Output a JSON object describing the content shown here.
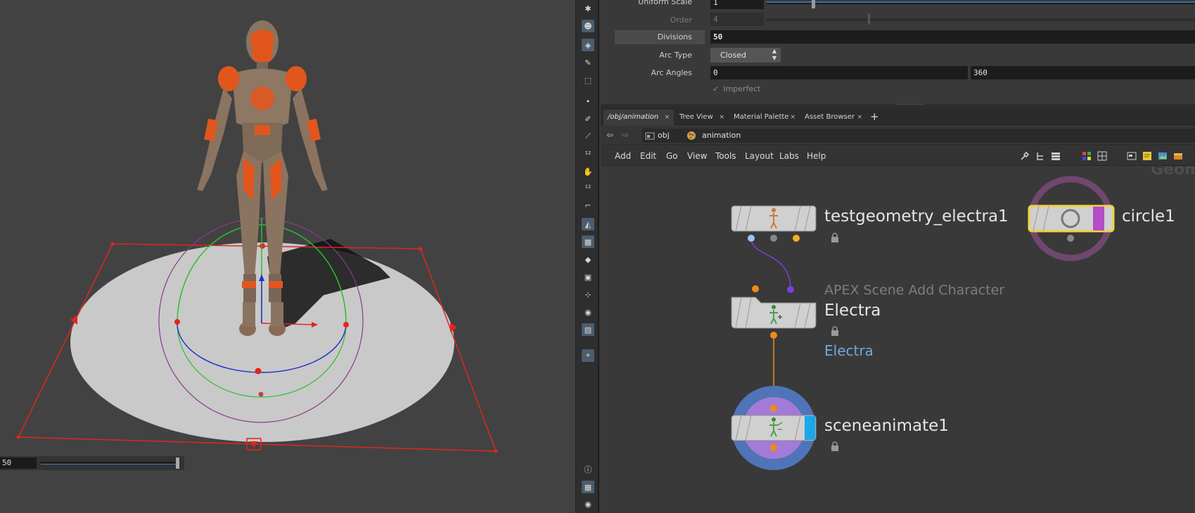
{
  "viewport": {
    "scale_value": "50"
  },
  "params": {
    "uniform_scale": {
      "label": "Uniform Scale",
      "value": "1"
    },
    "order": {
      "label": "Order",
      "value": "4"
    },
    "divisions": {
      "label": "Divisions",
      "value": "50"
    },
    "arc_type": {
      "label": "Arc Type",
      "value": "Closed"
    },
    "arc_angles": {
      "label": "Arc Angles",
      "value_start": "0",
      "value_end": "360"
    },
    "imperfect": {
      "label": "Imperfect"
    }
  },
  "tabs": [
    {
      "label": "/obj/animation",
      "active": true
    },
    {
      "label": "Tree View"
    },
    {
      "label": "Material Palette"
    },
    {
      "label": "Asset Browser"
    }
  ],
  "path": {
    "root": "obj",
    "current": "animation"
  },
  "network_menu": [
    "Add",
    "Edit",
    "Go",
    "View",
    "Tools",
    "Layout",
    "Labs",
    "Help"
  ],
  "nodes": {
    "testgeometry": {
      "name": "testgeometry_electra1"
    },
    "circle": {
      "name": "circle1"
    },
    "apex": {
      "type_label": "APEX Scene Add Character",
      "name": "Electra",
      "description": "Electra"
    },
    "sceneanimate": {
      "name": "sceneanimate1"
    }
  },
  "watermark": "Geom",
  "colors": {
    "selection_yellow": "#f2d33a",
    "wire_purple": "#7e3fd8",
    "wire_orange": "#f08a1a",
    "desc_blue": "#6fa8dc",
    "handle_red": "#e0261f"
  }
}
